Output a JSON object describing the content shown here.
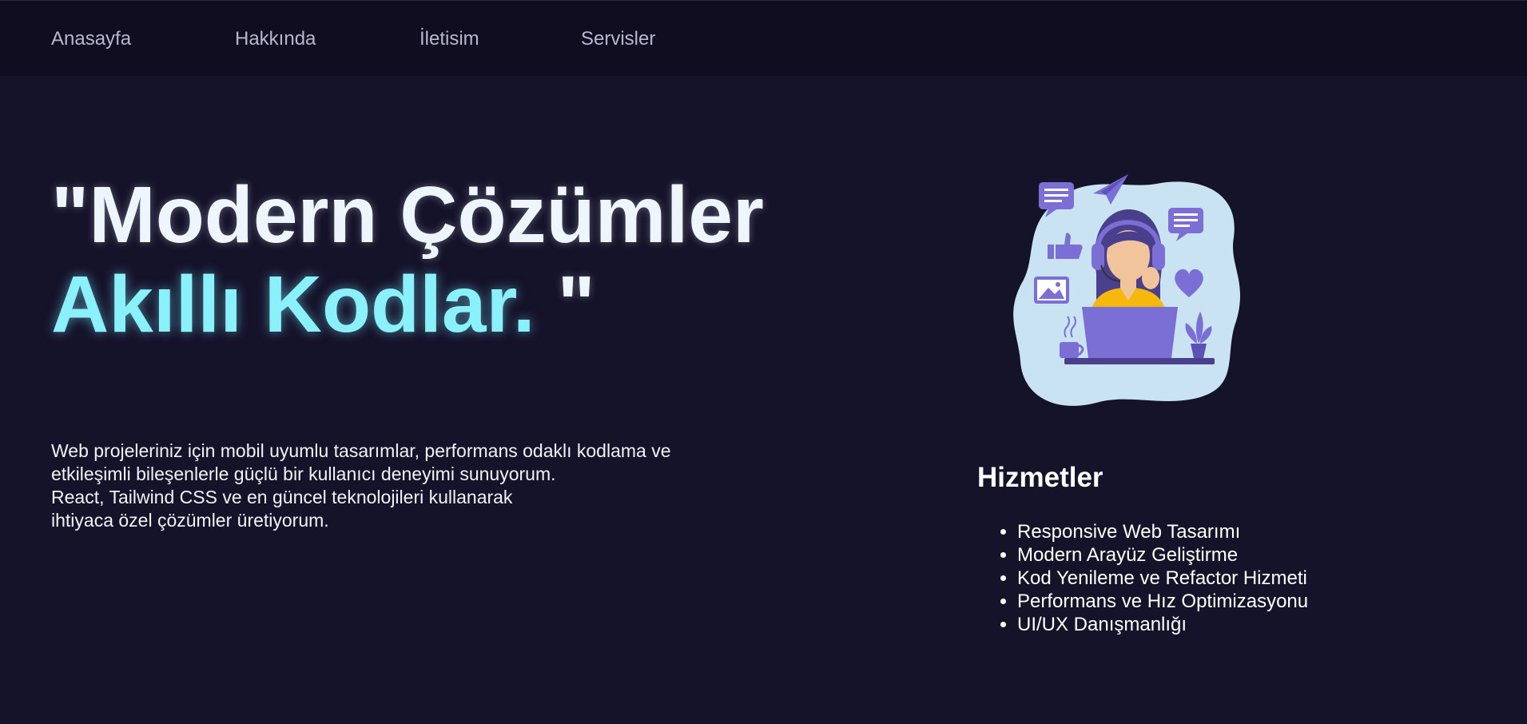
{
  "nav": {
    "items": [
      {
        "label": "Anasayfa"
      },
      {
        "label": "Hakkında"
      },
      {
        "label": "İletisim"
      },
      {
        "label": "Servisler"
      }
    ]
  },
  "hero": {
    "headline_line1": "\"Modern Çözümler",
    "headline_line2": "Akıllı Kodlar.",
    "headline_close": " \"",
    "intro_lines": [
      "Web projeleriniz için mobil uyumlu tasarımlar, performans odaklı kodlama ve",
      "etkileşimli bileşenlerle güçlü bir kullanıcı deneyimi sunuyorum.",
      "React, Tailwind CSS ve en güncel teknolojileri kullanarak",
      "ihtiyaca özel çözümler üretiyorum."
    ]
  },
  "illustration": {
    "icon": "customer-support-illustration"
  },
  "services": {
    "title": "Hizmetler",
    "items": [
      "Responsive Web Tasarımı",
      "Modern Arayüz Geliştirme",
      "Kod Yenileme ve Refactor Hizmeti",
      "Performans ve Hız Optimizasyonu",
      "UI/UX Danışmanlığı"
    ]
  },
  "colors": {
    "background": "#15132a",
    "navbar": "#0f0d1f",
    "accent_cyan": "#8af0fa",
    "illustration_purple": "#7b6fd6",
    "illustration_blob": "#c9e3f3"
  }
}
